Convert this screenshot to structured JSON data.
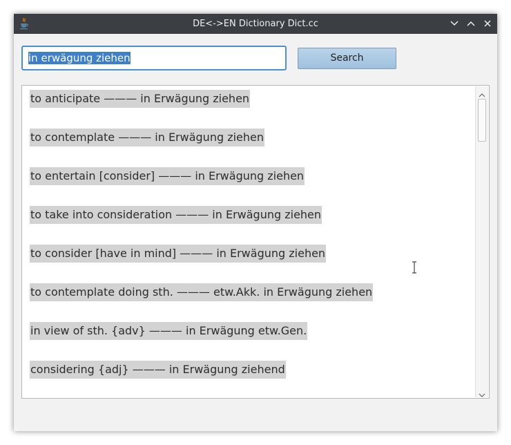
{
  "window": {
    "title": "DE<->EN Dictionary Dict.cc"
  },
  "icons": {
    "app": "java-cup-icon",
    "minimize": "chevron-down-icon",
    "maximize": "chevron-up-icon",
    "close": "close-icon",
    "scroll_up": "scroll-up-arrow-icon",
    "scroll_down": "scroll-down-arrow-icon",
    "cursor": "text-cursor-icon"
  },
  "search": {
    "value": "in erwägung ziehen",
    "button_label": "Search"
  },
  "results": [
    "to anticipate ——— in Erwägung ziehen",
    "to contemplate ——— in Erwägung ziehen",
    "to entertain [consider] ——— in Erwägung ziehen",
    "to take into consideration ——— in Erwägung ziehen",
    "to consider [have in mind] ——— in Erwägung ziehen",
    "to contemplate doing sth. ——— etw.Akk. in Erwägung ziehen",
    "in view of sth. {adv} ——— in Erwägung etw.Gen.",
    "considering {adj} ——— in Erwägung ziehend"
  ],
  "colors": {
    "titlebar": "#3b3f44",
    "selection": "#3d7fc9",
    "focus_border": "#4b8fd3",
    "item_highlight": "#d3d3d3",
    "button": "#b9d3e9"
  }
}
